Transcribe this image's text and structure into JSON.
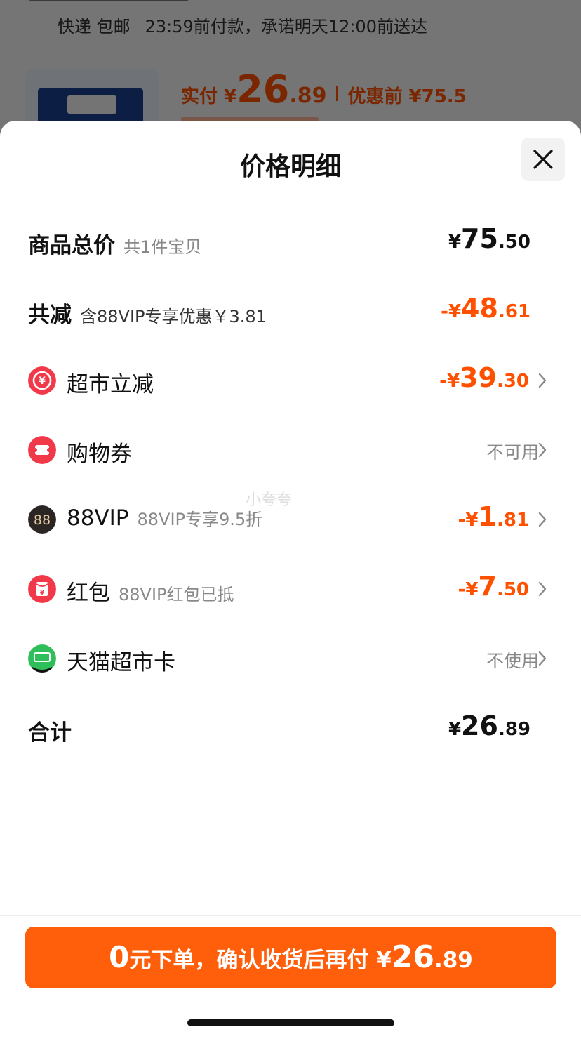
{
  "background": {
    "shipping": {
      "method": "快递 包邮",
      "promise": "23:59前付款，承诺明天12:00前送达"
    },
    "price": {
      "paid_label": "实付 ¥",
      "paid_int": "26",
      "paid_dec": ".89",
      "before_label": "优惠前 ¥75.5"
    }
  },
  "sheet": {
    "title": "价格明细",
    "watermark": "小夸夸",
    "rows": [
      {
        "label": "商品总价",
        "sub": "共1件宝贝",
        "sym": "¥",
        "int": "75",
        "dec": ".50"
      },
      {
        "label": "共减",
        "sub": "含88VIP专享优惠￥3.81",
        "sym": "-¥",
        "int": "48",
        "dec": ".61"
      },
      {
        "label": "超市立减",
        "sym": "-¥",
        "int": "39",
        "dec": ".30"
      },
      {
        "label": "购物券",
        "status": "不可用"
      },
      {
        "label": "88VIP",
        "sub": "88VIP专享9.5折",
        "sym": "-¥",
        "int": "1",
        "dec": ".81"
      },
      {
        "label": "红包",
        "sub": "88VIP红包已抵",
        "sym": "-¥",
        "int": "7",
        "dec": ".50"
      },
      {
        "label": "天猫超市卡",
        "status": "不使用"
      },
      {
        "label": "合计",
        "sym": "¥",
        "int": "26",
        "dec": ".89"
      }
    ],
    "cta": {
      "zero": "0",
      "text": "元下单，确认收货后再付 ¥",
      "int": "26",
      "dec": ".89"
    }
  },
  "icons": {
    "supermarket": "yen-circle-icon",
    "coupon": "ticket-icon",
    "vip": "88-badge-icon",
    "redpacket": "red-envelope-icon",
    "tmall_card": "tmall-supermarket-icon",
    "close": "close-icon",
    "chevron": "chevron-right-icon"
  },
  "colors": {
    "accent": "#ff5000",
    "cta": "#ff5f0a"
  }
}
